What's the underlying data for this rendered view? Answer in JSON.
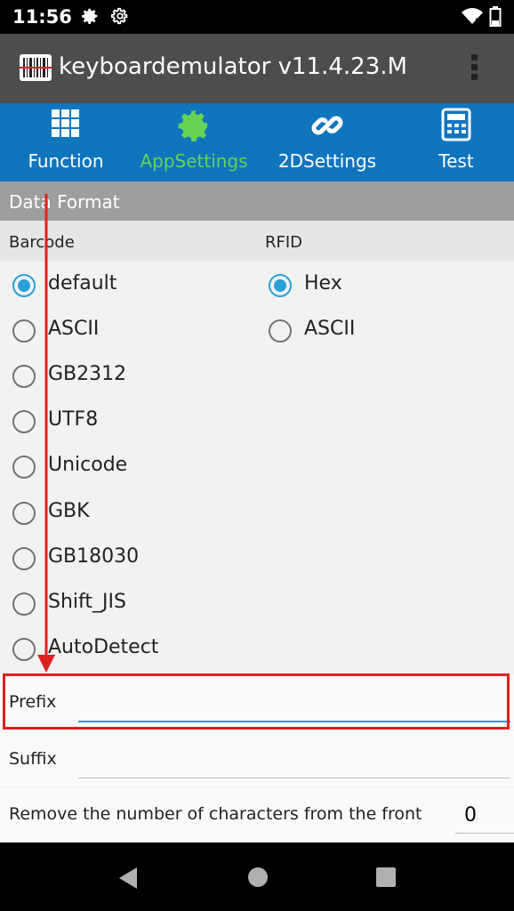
{
  "status_bar": {
    "time": "11:56"
  },
  "app_bar": {
    "title": "keyboardemulator v11.4.23.M"
  },
  "tabs": [
    {
      "label": "Function",
      "icon": "grid-icon"
    },
    {
      "label": "AppSettings",
      "icon": "gear-icon",
      "active": true
    },
    {
      "label": "2DSettings",
      "icon": "link-icon"
    },
    {
      "label": "Test",
      "icon": "calculator-icon"
    }
  ],
  "colors": {
    "tab_bar": "#0f75bd",
    "active_tab": "#67d256",
    "radio_accent": "#2aa0d8",
    "annotation": "#e02020"
  },
  "data_format": {
    "header": "Data Format",
    "barcode_label": "Barcode",
    "rfid_label": "RFID",
    "barcode_options": [
      "default",
      "ASCII",
      "GB2312",
      "UTF8",
      "Unicode",
      "GBK",
      "GB18030",
      "Shift_JIS",
      "AutoDetect"
    ],
    "barcode_selected": "default",
    "rfid_options": [
      "Hex",
      "ASCII"
    ],
    "rfid_selected": "Hex"
  },
  "prefix": {
    "label": "Prefix",
    "value": ""
  },
  "suffix": {
    "label": "Suffix",
    "value": ""
  },
  "remove_front": {
    "label": "Remove the number of characters from the front",
    "value": "0"
  }
}
